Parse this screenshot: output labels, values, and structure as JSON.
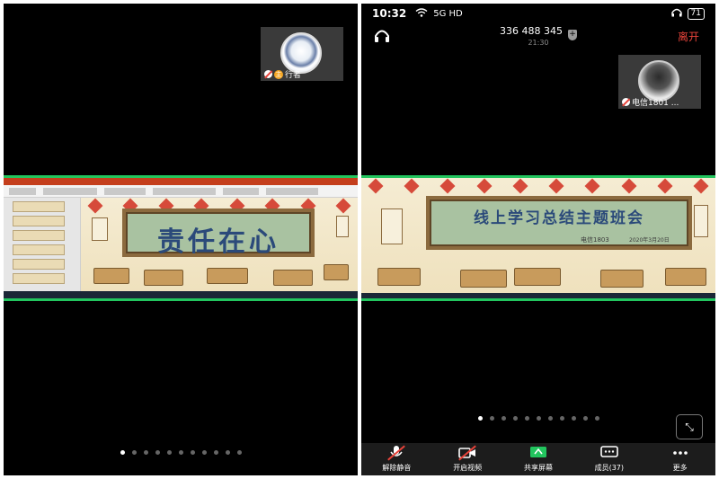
{
  "left": {
    "self_name": "行者",
    "shared_slide_title": "责任在心",
    "pages": 11,
    "active_page": 0
  },
  "right": {
    "status": {
      "time": "10:32",
      "network": "5G HD",
      "battery": "71"
    },
    "meeting": {
      "id": "336 488 345",
      "duration": "21:30",
      "leave_label": "离开"
    },
    "self_name": "电信1801 ...",
    "shared_slide_title": "线上学习总结主题班会",
    "shared_slide_class": "电信1803",
    "shared_slide_date": "2020年3月20日",
    "pages": 11,
    "active_page": 0,
    "fullscreen_icon": "fullscreen-icon",
    "toolbar": [
      {
        "label": "解除静音",
        "icon": "mic-muted-icon"
      },
      {
        "label": "开启视频",
        "icon": "video-off-icon"
      },
      {
        "label": "共享屏幕",
        "icon": "share-screen-icon"
      },
      {
        "label": "成员(37)",
        "icon": "members-icon"
      },
      {
        "label": "更多",
        "icon": "more-icon"
      }
    ]
  },
  "colors": {
    "accent_green": "#22c55e",
    "leave_red": "#e8433a",
    "host_orange": "#f5a623"
  }
}
